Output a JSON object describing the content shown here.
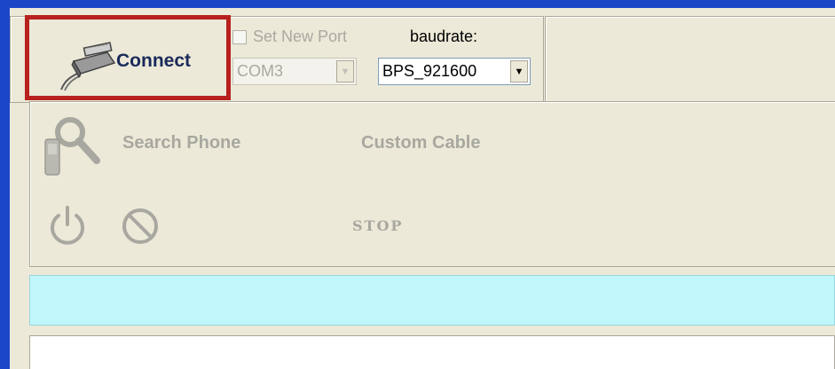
{
  "connect": {
    "label": "Connect",
    "icon": "cable-connector-icon"
  },
  "port": {
    "set_new_port_label": "Set New Port",
    "set_new_port_checked": false,
    "com_value": "COM3",
    "baudrate_label": "baudrate:",
    "baudrate_value": "BPS_921600"
  },
  "actions": {
    "search_phone_label": "Search Phone",
    "custom_cable_label": "Custom Cable",
    "stop_label": "STOP"
  },
  "colors": {
    "highlight": "#b8211e",
    "status_bar": "#bff7fb",
    "titlebar_blue": "#1a47c8"
  }
}
